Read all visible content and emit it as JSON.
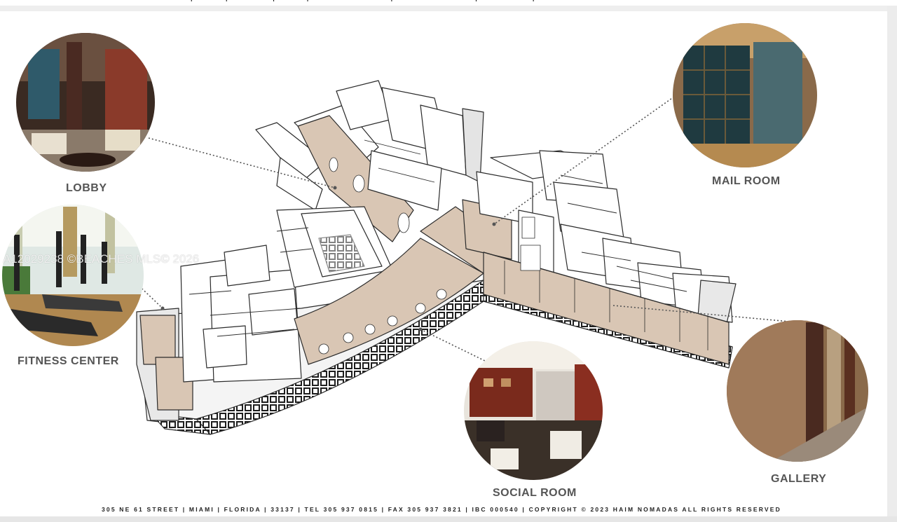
{
  "header": {
    "footer_text": "305 NE 61 STREET | MIAMI | FLORIDA | 33137 | TEL 305 937 0815 | FAX 305 937 3821 | IBC 000540 | COPYRIGHT © 2023 HAIM NOMADAS ALL RIGHTS RESERVED"
  },
  "amenities": {
    "lobby": "LOBBY",
    "mail_room": "MAIL ROOM",
    "fitness_center": "FITNESS CENTER",
    "social_room": "SOCIAL ROOM",
    "gallery": "GALLERY"
  },
  "watermark": "A12029238 ©BEACHES MLS© 2026",
  "colors": {
    "highlight_room": "#d9c6b4",
    "line": "#2b2b2b",
    "label": "#555555"
  }
}
